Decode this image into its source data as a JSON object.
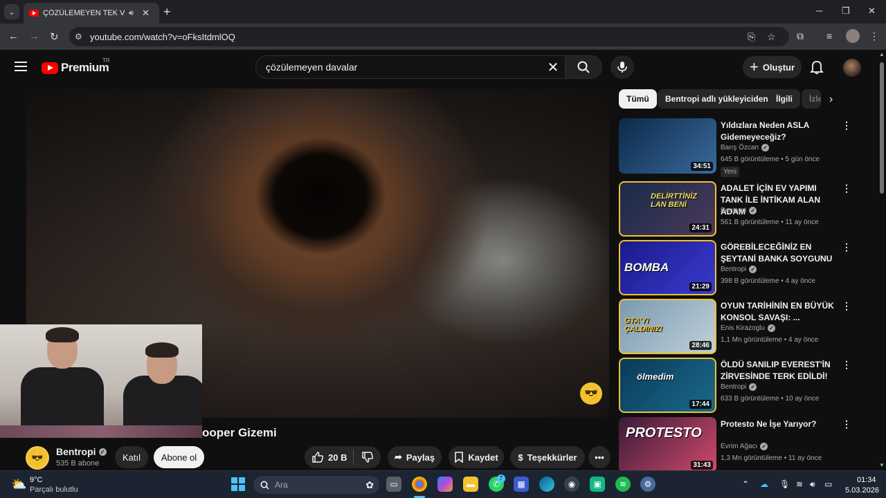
{
  "browser": {
    "tab_title": "ÇÖZÜLEMEYEN TEK VAKA -",
    "url": "youtube.com/watch?v=oFksItdmlOQ"
  },
  "masthead": {
    "logo_text": "Premium",
    "logo_badge": "TR",
    "search_query": "çözülemeyen davalar",
    "create_label": "Oluştur"
  },
  "video": {
    "title_visible": "ooper Gizemi",
    "channel_name": "Bentropi",
    "subscribers": "535 B abone",
    "join_label": "Katıl",
    "subscribe_label": "Abone ol",
    "like_count": "20 B",
    "share_label": "Paylaş",
    "save_label": "Kaydet",
    "thanks_label": "Teşekkürler"
  },
  "chips": [
    "Tümü",
    "Bentropi adlı yükleyiciden",
    "İlgili",
    "İzle"
  ],
  "recommendations": [
    {
      "title": "Yıldızlara Neden ASLA Gidemeyeceğiz?",
      "channel": "Barış Özcan",
      "verified": true,
      "meta": "645 B görüntüleme • 5 gün önce",
      "duration": "34:51",
      "badge": "Yeni",
      "thumb_text": "",
      "colors": [
        "#0b2a4a",
        "#3a6a9a"
      ]
    },
    {
      "title": "ADALET İÇİN EV YAPIMI TANK İLE İNTİKAM ALAN ADAM",
      "channel": "Bentropi",
      "verified": true,
      "meta": "561 B görüntüleme • 11 ay önce",
      "duration": "24:31",
      "badge": "",
      "thumb_text": "DELİRTTİNİZ LAN BENİ",
      "colors": [
        "#1a2a4a",
        "#4a3a5a"
      ]
    },
    {
      "title": "GÖREBİLECEĞİNİZ EN ŞEYTANİ BANKA SOYGUNU",
      "channel": "Bentropi",
      "verified": true,
      "meta": "398 B görüntüleme • 4 ay önce",
      "duration": "21:29",
      "badge": "",
      "thumb_text": "BOMBA",
      "colors": [
        "#1a1a8a",
        "#3a3ad0"
      ]
    },
    {
      "title": "OYUN TARİHİNİN EN BÜYÜK KONSOL SAVAŞI: ...",
      "channel": "Enis Kirazoglu",
      "verified": true,
      "meta": "1,1 Mn görüntüleme • 4 ay önce",
      "duration": "28:46",
      "badge": "",
      "thumb_text": "GTA'YI ÇALDINIZ!",
      "colors": [
        "#7a9ab0",
        "#c0d0d8"
      ]
    },
    {
      "title": "ÖLDÜ SANILIP EVEREST'İN ZİRVESİNDE TERK EDİLDİ!",
      "channel": "Bentropi",
      "verified": true,
      "meta": "633 B görüntüleme • 10 ay önce",
      "duration": "17:44",
      "badge": "",
      "thumb_text": "ölmedim",
      "colors": [
        "#0a3a5a",
        "#1a6a8a"
      ]
    },
    {
      "title": "Protesto Ne İşe Yarıyor?",
      "channel": "Evrim Ağacı",
      "verified": true,
      "meta": "1,3 Mn görüntüleme • 11 ay önce",
      "duration": "31:43",
      "badge": "",
      "thumb_text": "PROTESTO",
      "colors": [
        "#3a1a3a",
        "#d04a6a"
      ]
    }
  ],
  "taskbar": {
    "temp": "9°C",
    "weather": "Parçalı bulutlu",
    "search_placeholder": "Ara",
    "time": "01:34",
    "date": "5.03.2026",
    "whatsapp_badge": "7"
  },
  "colors": {
    "yt_red": "#ff0000",
    "bentropi_yellow": "#f2c230",
    "background": "#0f0f0f"
  }
}
